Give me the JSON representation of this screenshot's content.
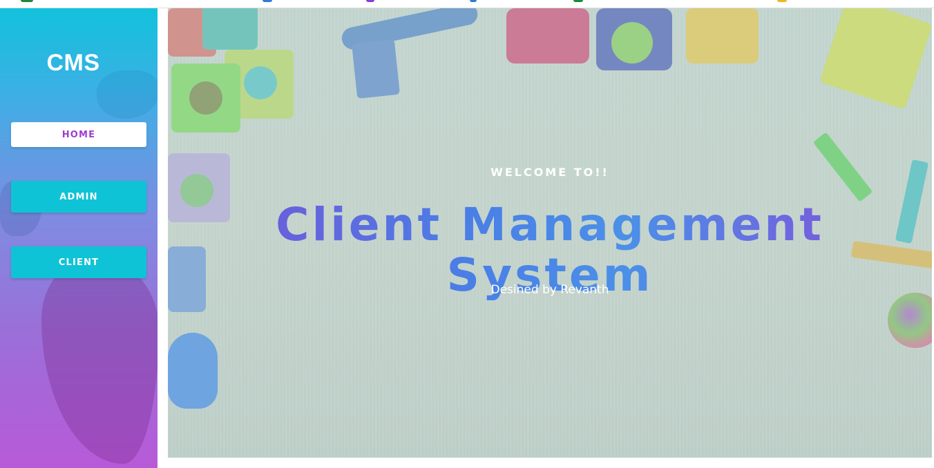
{
  "sidebar": {
    "brand": "CMS",
    "items": [
      {
        "label": "HOME",
        "active": true
      },
      {
        "label": "ADMIN",
        "active": false
      },
      {
        "label": "CLIENT",
        "active": false
      }
    ]
  },
  "hero": {
    "welcome": "WELCOME TO!!",
    "title": "Client Management System",
    "credit": "Desined by Revanth"
  },
  "colors": {
    "sidebar_gradient_top": "#12c2dc",
    "sidebar_gradient_bottom": "#b85ad8",
    "nav_button_bg": "#0fc3d6",
    "active_nav_text": "#a03dd0",
    "title_gradient_start": "#7a4fd6",
    "title_gradient_end": "#8a46d8"
  }
}
